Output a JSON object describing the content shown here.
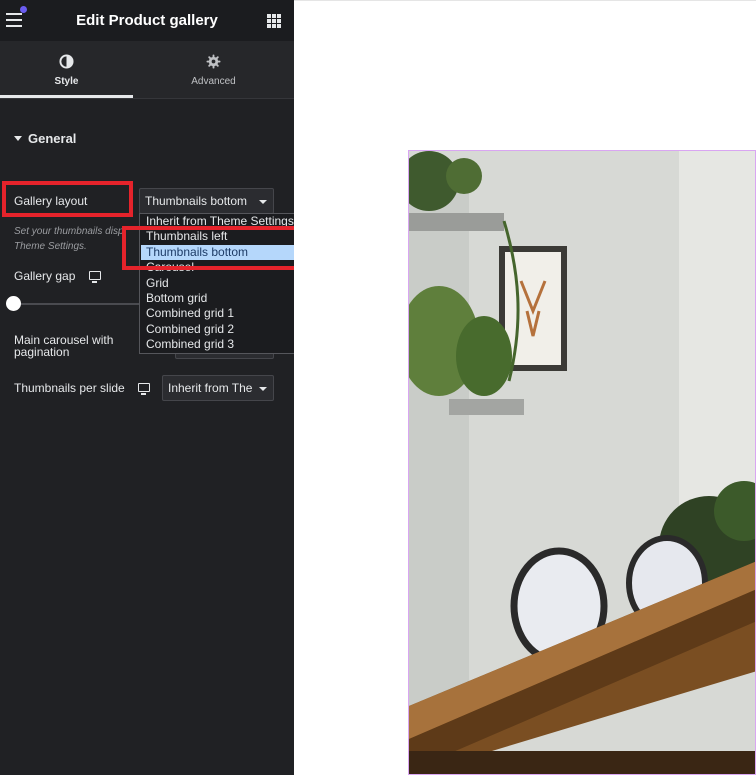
{
  "header": {
    "title": "Edit Product gallery"
  },
  "tabs": [
    {
      "label": "Style",
      "icon": "contrast-icon",
      "active": true
    },
    {
      "label": "Advanced",
      "icon": "gear-icon",
      "active": false
    }
  ],
  "section": {
    "title": "General"
  },
  "gallery_layout": {
    "label": "Gallery layout",
    "value": "Thumbnails bottom",
    "description_lines": [
      "Set your thumbnails disp",
      "Theme Settings."
    ],
    "options": [
      "Inherit from Theme Settings",
      "Thumbnails left",
      "Thumbnails bottom",
      "Carousel",
      "Grid",
      "Bottom grid",
      "Combined grid 1",
      "Combined grid 2",
      "Combined grid 3"
    ],
    "selected_option": "Thumbnails bottom"
  },
  "gallery_gap": {
    "label": "Gallery gap",
    "icon": "desktop-icon"
  },
  "main_carousel": {
    "label_lines": [
      "Main carousel with",
      "pagination"
    ]
  },
  "thumbnails_per_slide": {
    "label": "Thumbnails per slide",
    "icon": "desktop-icon",
    "value": "Inherit from The"
  },
  "colors": {
    "panel_bg": "#202124",
    "accent_dot": "#6a5cf0",
    "highlight": "#e5232b",
    "selected_option_bg": "#b5d7fb",
    "preview_border": "#d9a6f2"
  }
}
